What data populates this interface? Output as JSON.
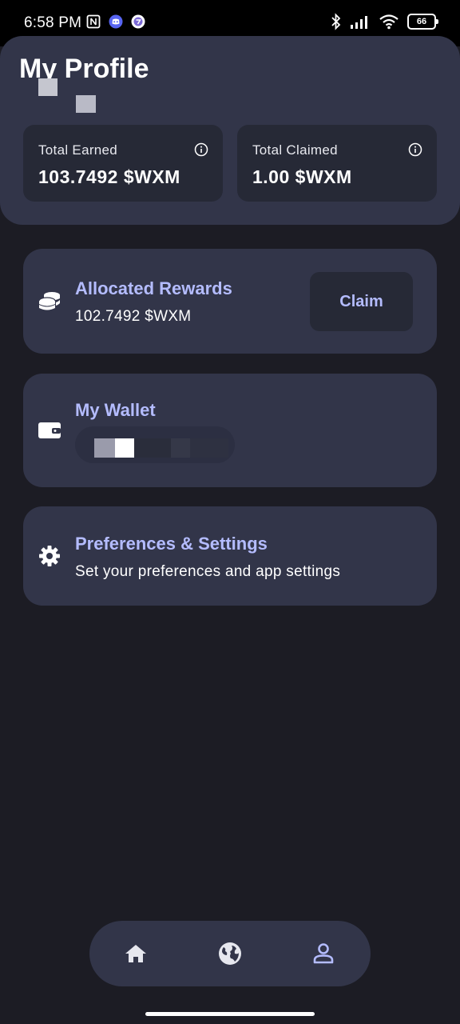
{
  "status_bar": {
    "time": "6:58 PM",
    "battery": "66",
    "left_icons": [
      "nfc-icon",
      "discord-icon",
      "app-icon"
    ],
    "right_icons": [
      "bluetooth-icon",
      "signal-icon",
      "wifi-icon",
      "battery-icon"
    ]
  },
  "header": {
    "title": "My Profile",
    "stats": [
      {
        "label": "Total Earned",
        "value": "103.7492 $WXM",
        "icon": "info-icon"
      },
      {
        "label": "Total Claimed",
        "value": "1.00 $WXM",
        "icon": "info-icon"
      }
    ]
  },
  "rewards": {
    "icon": "coins-icon",
    "title": "Allocated Rewards",
    "value": "102.7492 $WXM",
    "claim_label": "Claim"
  },
  "wallet": {
    "icon": "wallet-icon",
    "title": "My Wallet"
  },
  "settings": {
    "icon": "gear-icon",
    "title": "Preferences & Settings",
    "subtitle": "Set your preferences and app settings"
  },
  "bottom_nav": {
    "items": [
      {
        "icon": "home-icon",
        "active": false
      },
      {
        "icon": "globe-icon",
        "active": false
      },
      {
        "icon": "profile-icon",
        "active": true
      }
    ]
  },
  "colors": {
    "background": "#1c1c24",
    "card": "#323549",
    "card_inner": "#262936",
    "accent": "#b4bcff"
  }
}
